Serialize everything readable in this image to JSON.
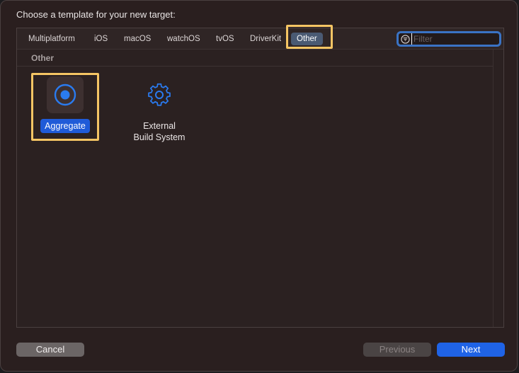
{
  "dialog": {
    "title": "Choose a template for your new target:"
  },
  "tabs": [
    {
      "label": "Multiplatform",
      "selected": false
    },
    {
      "label": "iOS",
      "selected": false
    },
    {
      "label": "macOS",
      "selected": false
    },
    {
      "label": "watchOS",
      "selected": false
    },
    {
      "label": "tvOS",
      "selected": false
    },
    {
      "label": "DriverKit",
      "selected": false
    },
    {
      "label": "Other",
      "selected": true
    }
  ],
  "search": {
    "placeholder": "Filter",
    "value": "",
    "icon": "filter-icon"
  },
  "section": {
    "title": "Other"
  },
  "templates": [
    {
      "label": "Aggregate",
      "icon": "aggregate-target-icon",
      "selected": true
    },
    {
      "label_line1": "External",
      "label_line2": "Build System",
      "icon": "gear-icon",
      "selected": false
    }
  ],
  "buttons": {
    "cancel": "Cancel",
    "previous": "Previous",
    "next": "Next"
  },
  "colors": {
    "accent": "#1f63e6",
    "highlight": "#f5c564",
    "icon_blue": "#2a7bf0"
  }
}
